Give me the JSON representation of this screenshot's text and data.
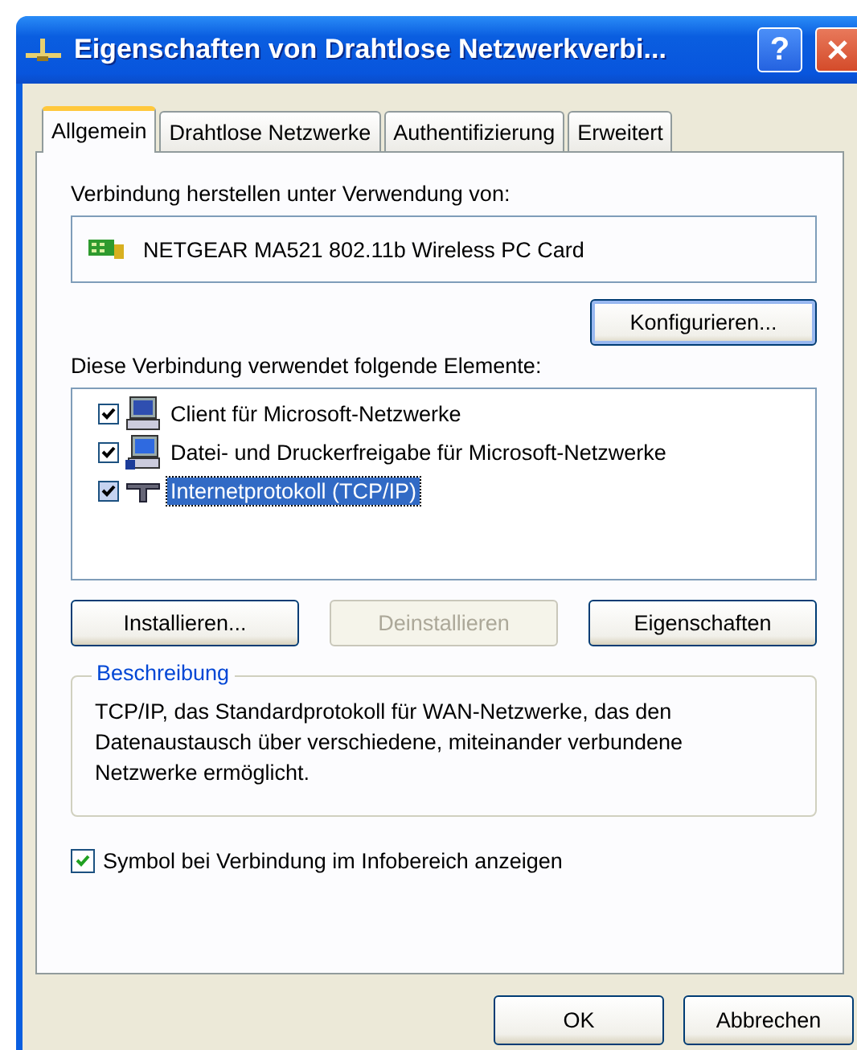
{
  "window": {
    "title": "Eigenschaften von Drahtlose Netzwerkverbi...",
    "help_button": "?"
  },
  "tabs": [
    {
      "label": "Allgemein",
      "selected": true
    },
    {
      "label": "Drahtlose Netzwerke",
      "selected": false
    },
    {
      "label": "Authentifizierung",
      "selected": false
    },
    {
      "label": "Erweitert",
      "selected": false
    }
  ],
  "connect_using": {
    "label": "Verbindung herstellen unter Verwendung von:",
    "device": "NETGEAR MA521 802.11b Wireless PC Card",
    "configure_button": "Konfigurieren..."
  },
  "components": {
    "label": "Diese Verbindung verwendet folgende Elemente:",
    "items": [
      {
        "kind": "client",
        "label": "Client für Microsoft-Netzwerke",
        "checked": true,
        "selected": false
      },
      {
        "kind": "service",
        "label": "Datei- und Druckerfreigabe für Microsoft-Netzwerke",
        "checked": true,
        "selected": false
      },
      {
        "kind": "protocol",
        "label": "Internetprotokoll (TCP/IP)",
        "checked": true,
        "selected": true
      }
    ],
    "buttons": [
      {
        "label": "Installieren...",
        "disabled": false
      },
      {
        "label": "Deinstallieren",
        "disabled": true
      },
      {
        "label": "Eigenschaften",
        "disabled": false
      }
    ]
  },
  "description": {
    "title": "Beschreibung",
    "text": "TCP/IP, das Standardprotokoll für WAN-Netzwerke, das den Datenaustausch über verschiedene, miteinander verbundene Netzwerke ermöglicht."
  },
  "tray_icon_option": {
    "label": "Symbol bei Verbindung im Infobereich anzeigen",
    "checked": true
  },
  "dialog_buttons": [
    {
      "label": "OK"
    },
    {
      "label": "Abbrechen"
    }
  ]
}
